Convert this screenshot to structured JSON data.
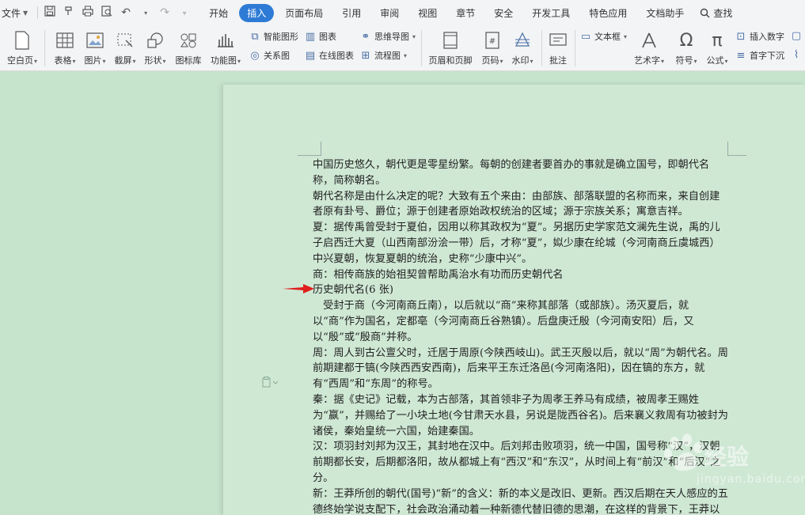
{
  "menubar": {
    "file_label": "文件",
    "tabs": [
      {
        "label": "开始",
        "active": false
      },
      {
        "label": "插入",
        "active": true
      },
      {
        "label": "页面布局",
        "active": false
      },
      {
        "label": "引用",
        "active": false
      },
      {
        "label": "审阅",
        "active": false
      },
      {
        "label": "视图",
        "active": false
      },
      {
        "label": "章节",
        "active": false
      },
      {
        "label": "安全",
        "active": false
      },
      {
        "label": "开发工具",
        "active": false
      },
      {
        "label": "特色应用",
        "active": false
      },
      {
        "label": "文档助手",
        "active": false
      }
    ],
    "search_label": "查找"
  },
  "ribbon": {
    "blank_page": "空白页",
    "table": "表格",
    "picture": "图片",
    "screenshot": "截屏",
    "shape": "形状",
    "icon_lib": "图标库",
    "func_chart": "功能图",
    "smart_art": "智能图形",
    "chart": "图表",
    "mind_map": "思维导图",
    "relation": "关系图",
    "online_chart": "在线图表",
    "flowchart": "流程图",
    "header_footer": "页眉和页脚",
    "page_num": "页码",
    "watermark": "水印",
    "comment": "批注",
    "textbox": "文本框",
    "art_text": "艺术字",
    "symbol": "符号",
    "formula": "公式",
    "insert_num": "插入数字",
    "drop_cap": "首字下沉"
  },
  "document": {
    "paragraphs": [
      "中国历史悠久，朝代更是零星纷繁。每朝的创建者要首办的事就是确立国号，即朝代名称，简称朝名。",
      "朝代名称是由什么决定的呢？大致有五个来由：由部族、部落联盟的名称而来，来自创建者原有卦号、爵位；源于创建者原始政权统治的区域；源于宗族关系；寓意吉祥。",
      "夏：据传禹曾受封于夏伯，因用以称其政权为“夏”。另据历史学家范文澜先生说，禹的儿子启西迁大夏（山西南部汾浍一带）后，才称“夏”，姒少康在纶城（今河南商丘虞城西）中兴夏朝，恢复夏朝的统治，史称“少康中兴”。",
      "商：相传商族的始祖契曾帮助禹治水有功而历史朝代名",
      "历史朝代名(6 张)",
      "　受封于商（今河南商丘南），以后就以“商”来称其部落（或部族）。汤灭夏后，就以“商”作为国名，定都亳（今河南商丘谷熟镇）。后盘庚迁殷（今河南安阳）后，又以“殷”或“殷商”并称。",
      "周：周人到古公亶父时，迁居于周原(今陕西岐山)。武王灭殷以后，就以“周”为朝代名。周前期建都于镐(今陕西西安西南)，后来平王东迁洛邑(今河南洛阳)，因在镐的东方，就有“西周”和“东周”的称号。",
      "秦：据《史记》记载，本为古部落，其首领非子为周孝王养马有成绩，被周孝王赐姓为“嬴”，并赐给了一小块土地(今甘肃天水县，另说是陇西谷名)。后来襄义救周有功被封为诸侯，秦始皇统一六国，始建秦国。",
      "汉：项羽封刘邦为汉王，其封地在汉中。后刘邦击败项羽，统一中国，国号称“汉”，汉朝前期都长安，后期都洛阳，故从都城上有“西汉”和“东汉”，从时间上有“前汉”和“后汉”之分。",
      "新：王莽所创的朝代(国号)“新”的含义：新的本义是改旧、更新。西汉后期在天人感应的五德终始学说支配下，社会政治涌动着一种新德代替旧德的思潮，在这样的背景下，王莽以"
    ]
  },
  "watermark": {
    "brand": "经验",
    "url": "jingyan.baidu.com"
  },
  "colors": {
    "accent": "#2e7bd6",
    "background": "#c6e3cc",
    "page": "#cfe8d4",
    "arrow": "#e02020"
  }
}
